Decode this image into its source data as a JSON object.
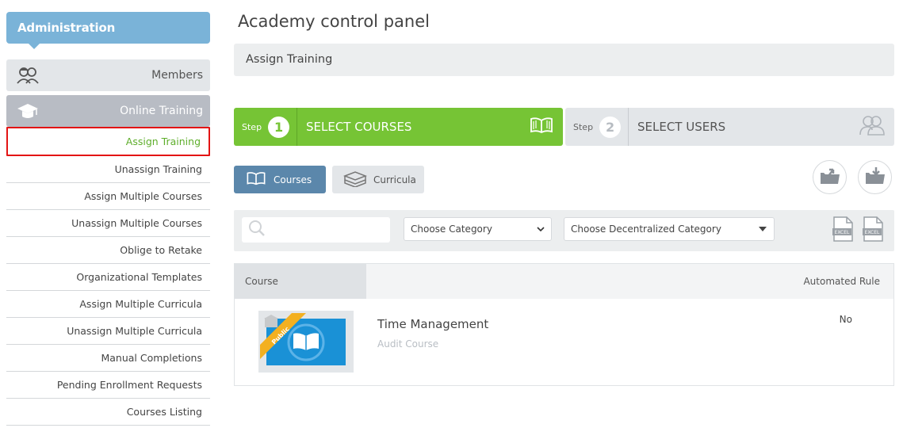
{
  "sidebar": {
    "header": "Administration",
    "sections": [
      {
        "label": "Members",
        "icon": "members-icon"
      },
      {
        "label": "Online Training",
        "icon": "graduation-cap-icon"
      }
    ],
    "items": [
      {
        "label": "Assign Training",
        "active": true
      },
      {
        "label": "Unassign Training"
      },
      {
        "label": "Assign Multiple Courses"
      },
      {
        "label": "Unassign Multiple Courses"
      },
      {
        "label": "Oblige to Retake"
      },
      {
        "label": "Organizational Templates"
      },
      {
        "label": "Assign Multiple Curricula"
      },
      {
        "label": "Unassign Multiple Curricula"
      },
      {
        "label": "Manual Completions"
      },
      {
        "label": "Pending Enrollment Requests"
      },
      {
        "label": "Courses Listing"
      }
    ]
  },
  "main": {
    "title": "Academy control panel",
    "subtitle": "Assign Training",
    "steps": [
      {
        "prefix": "Step",
        "number": "1",
        "label": "SELECT COURSES",
        "icon": "open-book-icon",
        "active": true
      },
      {
        "prefix": "Step",
        "number": "2",
        "label": "SELECT USERS",
        "icon": "users-icon",
        "active": false
      }
    ],
    "tabs": [
      {
        "label": "Courses",
        "icon": "open-book-icon",
        "active": true
      },
      {
        "label": "Curricula",
        "icon": "books-stack-icon",
        "active": false
      }
    ],
    "filters": {
      "search_value": "",
      "category": "Choose Category",
      "decentralized_category": "Choose Decentralized Category",
      "export_label": "EXCEL"
    },
    "table": {
      "headers": [
        "Course",
        "Automated Rule"
      ],
      "rows": [
        {
          "title": "Time Management",
          "type": "Audit Course",
          "rule": "No",
          "badge": "Public"
        }
      ]
    }
  },
  "colors": {
    "accent_blue": "#7ab3d8",
    "step_green": "#76c435",
    "active_item_green": "#5eae2b",
    "tab_blue": "#5b87ab",
    "highlight_red": "#e31414"
  }
}
